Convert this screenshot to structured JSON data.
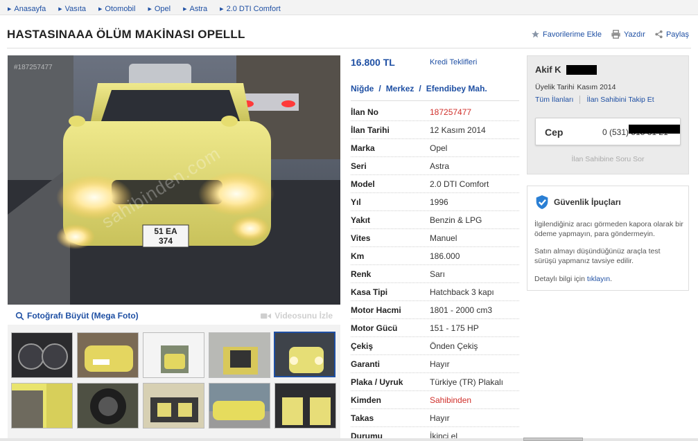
{
  "breadcrumb": [
    "Anasayfa",
    "Vasıta",
    "Otomobil",
    "Opel",
    "Astra",
    "2.0 DTI Comfort"
  ],
  "listing": {
    "title": "HASTASINAAA ÖLÜM MAKİNASI OPELLL",
    "price": "16.800 TL",
    "credit_link": "Kredi Teklifleri",
    "location": [
      "Niğde",
      "Merkez",
      "Efendibey Mah."
    ],
    "photo_id": "#187257477",
    "watermark": "sahibinden.com",
    "plate_top": "51  EA",
    "plate_bottom": "374"
  },
  "actions": {
    "favorite": "Favorilerime Ekle",
    "print": "Yazdır",
    "share": "Paylaş"
  },
  "media": {
    "mega_photo": "Fotoğrafı Büyüt (Mega Foto)",
    "video": "Videosunu İzle"
  },
  "specs": [
    {
      "label": "İlan No",
      "value": "187257477",
      "red": true
    },
    {
      "label": "İlan Tarihi",
      "value": "12 Kasım 2014"
    },
    {
      "label": "Marka",
      "value": "Opel"
    },
    {
      "label": "Seri",
      "value": "Astra"
    },
    {
      "label": "Model",
      "value": "2.0 DTI Comfort"
    },
    {
      "label": "Yıl",
      "value": "1996"
    },
    {
      "label": "Yakıt",
      "value": "Benzin & LPG"
    },
    {
      "label": "Vites",
      "value": "Manuel"
    },
    {
      "label": "Km",
      "value": "186.000"
    },
    {
      "label": "Renk",
      "value": "Sarı"
    },
    {
      "label": "Kasa Tipi",
      "value": "Hatchback 3 kapı"
    },
    {
      "label": "Motor Hacmi",
      "value": "1801 - 2000 cm3"
    },
    {
      "label": "Motor Gücü",
      "value": "151 - 175 HP"
    },
    {
      "label": "Çekiş",
      "value": "Önden Çekiş"
    },
    {
      "label": "Garanti",
      "value": "Hayır"
    },
    {
      "label": "Plaka / Uyruk",
      "value": "Türkiye (TR) Plakalı"
    },
    {
      "label": "Kimden",
      "value": "Sahibinden",
      "red": true
    },
    {
      "label": "Takas",
      "value": "Hayır"
    },
    {
      "label": "Durumu",
      "value": "İkinci el"
    }
  ],
  "seller": {
    "name": "Akif K",
    "member_label": "Üyelik Tarihi",
    "member_since": "Kasım 2014",
    "all_listings": "Tüm İlanları",
    "follow": "İlan Sahibini Takip Et",
    "phone_label": "Cep",
    "phone": "0 (531) 515 ",
    "phone_tail": "31 21",
    "ask": "İlan Sahibine Soru Sor"
  },
  "safety": {
    "title": "Güvenlik İpuçları",
    "tip1": "İlgilendiğiniz aracı görmeden kapora olarak bir ödeme yapmayın, para göndermeyin.",
    "tip2": "Satın almayı düşündüğünüz araçla test sürüşü yapmanız tavsiye edilir.",
    "tip3_prefix": "Detaylı bilgi için ",
    "tip3_link": "tıklayın",
    "tip3_suffix": "."
  },
  "colors": {
    "link_blue": "#1e4fa3",
    "accent_red": "#d0302b"
  }
}
